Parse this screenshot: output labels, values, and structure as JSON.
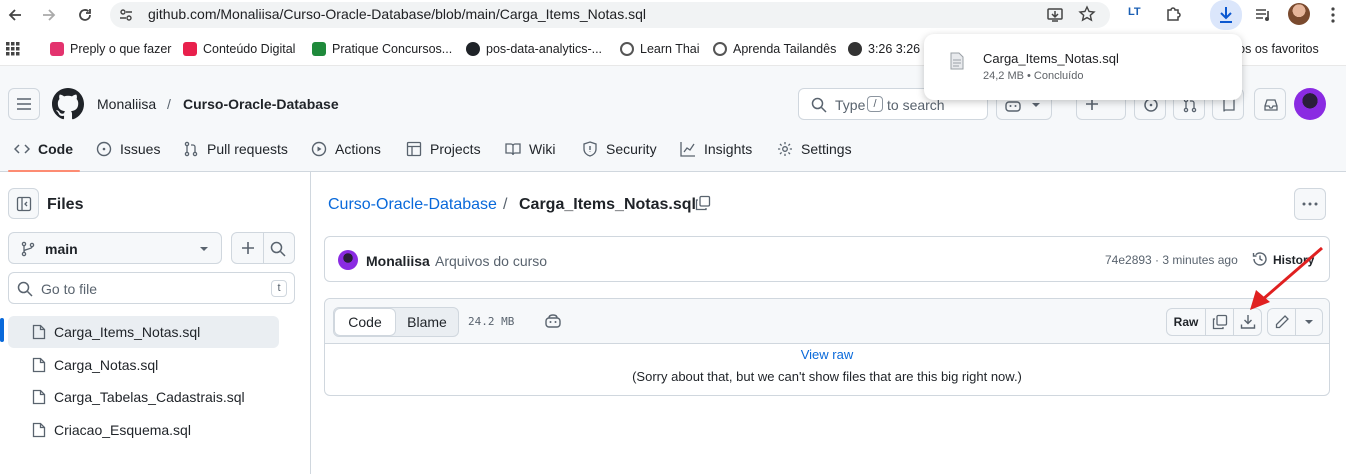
{
  "browser": {
    "url": "github.com/Monaliisa/Curso-Oracle-Database/blob/main/Carga_Items_Notas.sql",
    "bookmarks": [
      {
        "label": "Preply o que fazer",
        "color": "#e3336e"
      },
      {
        "label": "Conteúdo Digital",
        "color": "#e8204c"
      },
      {
        "label": "Pratique Concursos...",
        "color": "#1f8a3b"
      },
      {
        "label": "pos-data-analytics-...",
        "color": "#1f2328"
      },
      {
        "label": "Learn Thai",
        "color": "#555555"
      },
      {
        "label": "Aprenda Tailandês",
        "color": "#555555"
      },
      {
        "label": "3:26 3:26",
        "color": "#333333"
      }
    ],
    "all_bookmarks": "Todos os favoritos",
    "download": {
      "filename": "Carga_Items_Notas.sql",
      "status": "24,2 MB • Concluído"
    }
  },
  "header": {
    "owner": "Monaliisa",
    "separator": "/",
    "repo": "Curso-Oracle-Database",
    "search_type": "Type",
    "search_key": "/",
    "search_rest": "to search"
  },
  "tabs": [
    {
      "label": "Code"
    },
    {
      "label": "Issues"
    },
    {
      "label": "Pull requests"
    },
    {
      "label": "Actions"
    },
    {
      "label": "Projects"
    },
    {
      "label": "Wiki"
    },
    {
      "label": "Security"
    },
    {
      "label": "Insights"
    },
    {
      "label": "Settings"
    }
  ],
  "sidebar": {
    "title": "Files",
    "branch": "main",
    "search_placeholder": "Go to file",
    "search_key": "t",
    "files": [
      {
        "name": "Carga_Items_Notas.sql"
      },
      {
        "name": "Carga_Notas.sql"
      },
      {
        "name": "Carga_Tabelas_Cadastrais.sql"
      },
      {
        "name": "Criacao_Esquema.sql"
      }
    ]
  },
  "main": {
    "breadcrumb_repo": "Curso-Oracle-Database",
    "breadcrumb_sep": "/",
    "file_name": "Carga_Items_Notas.sql",
    "commit": {
      "author": "Monaliisa",
      "message": "Arquivos do curso",
      "meta": "74e2893 · 3 minutes ago",
      "history": "History"
    },
    "toolbar": {
      "code": "Code",
      "blame": "Blame",
      "size": "24.2 MB",
      "raw": "Raw"
    },
    "view_raw": "View raw",
    "too_big": "(Sorry about that, but we can't show files that are this big right now.)"
  },
  "colors": {
    "accent": "#0969da",
    "tab_underline": "#fd8c73",
    "arrow": "#e02020"
  }
}
